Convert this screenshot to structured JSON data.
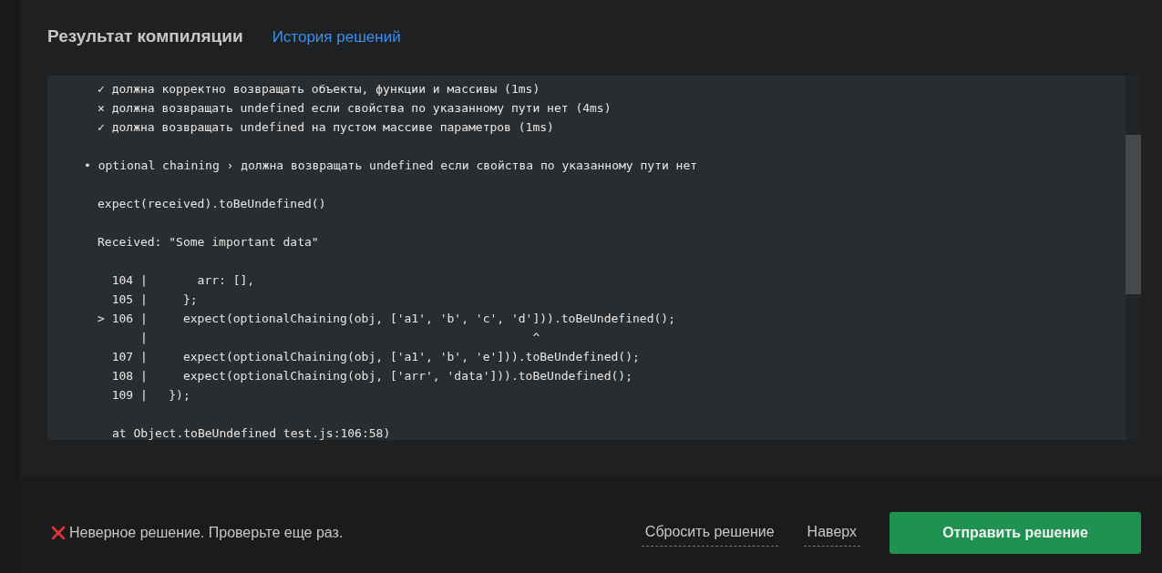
{
  "header": {
    "title": "Результат компиляции",
    "history_link": "История решений"
  },
  "console": {
    "lines": [
      {
        "kind": "test",
        "text": "✓ должна корректно возвращать объекты, функции и массивы (1ms)"
      },
      {
        "kind": "test",
        "text": "✕ должна возвращать undefined если свойства по указанному пути нет (4ms)"
      },
      {
        "kind": "test",
        "text": "✓ должна возвращать undefined на пустом массиве параметров (1ms)"
      },
      {
        "kind": "blank"
      },
      {
        "kind": "title",
        "text": "• optional chaining › должна возвращать undefined если свойства по указанному пути нет"
      },
      {
        "kind": "blank"
      },
      {
        "kind": "text",
        "text": "expect(received).toBeUndefined()"
      },
      {
        "kind": "blank"
      },
      {
        "kind": "text",
        "text": "Received: \"Some important data\""
      },
      {
        "kind": "blank"
      },
      {
        "kind": "code",
        "text": "  104 |       arr: [],"
      },
      {
        "kind": "code",
        "text": "  105 |     };"
      },
      {
        "kind": "code",
        "text": "> 106 |     expect(optionalChaining(obj, ['a1', 'b', 'c', 'd'])).toBeUndefined();"
      },
      {
        "kind": "code",
        "text": "      |                                                      ^"
      },
      {
        "kind": "code",
        "text": "  107 |     expect(optionalChaining(obj, ['a1', 'b', 'e'])).toBeUndefined();"
      },
      {
        "kind": "code",
        "text": "  108 |     expect(optionalChaining(obj, ['arr', 'data'])).toBeUndefined();"
      },
      {
        "kind": "code",
        "text": "  109 |   });"
      },
      {
        "kind": "blank"
      },
      {
        "kind": "trace",
        "text": "at Object.toBeUndefined test.js:106:58)"
      }
    ]
  },
  "footer": {
    "status": "Неверное решение. Проверьте еще раз.",
    "reset_link": "Сбросить решение",
    "top_link": "Наверх",
    "submit_button": "Отправить решение"
  }
}
